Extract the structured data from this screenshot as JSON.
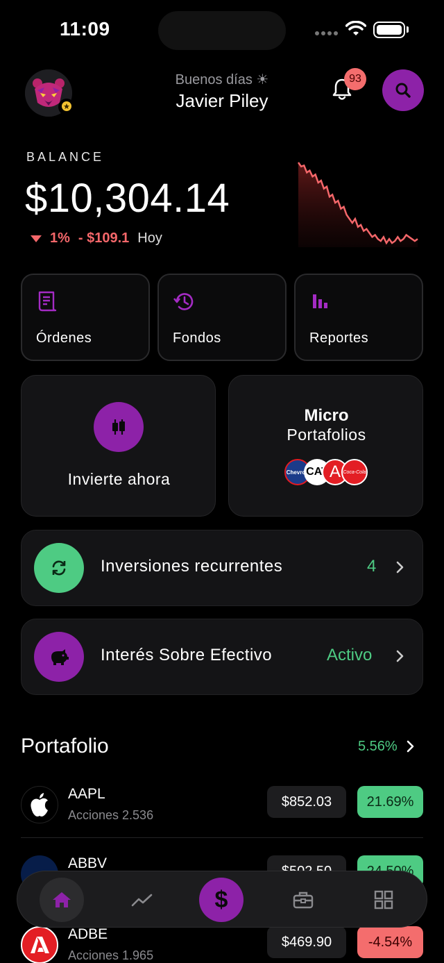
{
  "status_bar": {
    "time": "11:09"
  },
  "header": {
    "greeting": "Buenos días ☀",
    "user_name": "Javier Piley",
    "notification_count": "93"
  },
  "balance": {
    "label": "BALANCE",
    "value": "$10,304.14",
    "change_pct": "1%",
    "change_abs": "- $109.1",
    "change_period": "Hoy",
    "sparkline": [
      100,
      96,
      97,
      90,
      92,
      86,
      88,
      80,
      82,
      74,
      76,
      66,
      68,
      60,
      62,
      54,
      56,
      48,
      44,
      40,
      44,
      36,
      38,
      32,
      34,
      30,
      26,
      28,
      24,
      22,
      26,
      20,
      24,
      20,
      22,
      26,
      22,
      24,
      28,
      26,
      24,
      22,
      24
    ],
    "trend_color": "#f4676a"
  },
  "quick_actions": [
    {
      "label": "Órdenes",
      "icon": "receipt-icon"
    },
    {
      "label": "Fondos",
      "icon": "history-icon"
    },
    {
      "label": "Reportes",
      "icon": "bar-chart-icon"
    }
  ],
  "invest": {
    "label": "Invierte ahora",
    "icon": "candlestick-icon"
  },
  "micro": {
    "title": "Micro",
    "subtitle": "Portafolios",
    "logos": [
      "Chevron",
      "CAT",
      "A",
      "Coca-Cola"
    ]
  },
  "recurring": {
    "label": "Inversiones recurrentes",
    "value": "4"
  },
  "cash_interest": {
    "label": "Interés Sobre Efectivo",
    "value": "Activo"
  },
  "portfolio": {
    "title": "Portafolio",
    "performance": "5.56%",
    "stocks": [
      {
        "symbol": "AAPL",
        "shares": "Acciones 2.536",
        "price": "$852.03",
        "change": "21.69%",
        "positive": true
      },
      {
        "symbol": "ABBV",
        "shares": "",
        "price": "$502.50",
        "change": "24.50%",
        "positive": true
      },
      {
        "symbol": "ADBE",
        "shares": "Acciones 1.965",
        "price": "$469.90",
        "change": "-4.54%",
        "positive": false
      }
    ]
  },
  "accent_color": "#8d22a8",
  "positive_color": "#4ecb83",
  "negative_color": "#f46d6d"
}
